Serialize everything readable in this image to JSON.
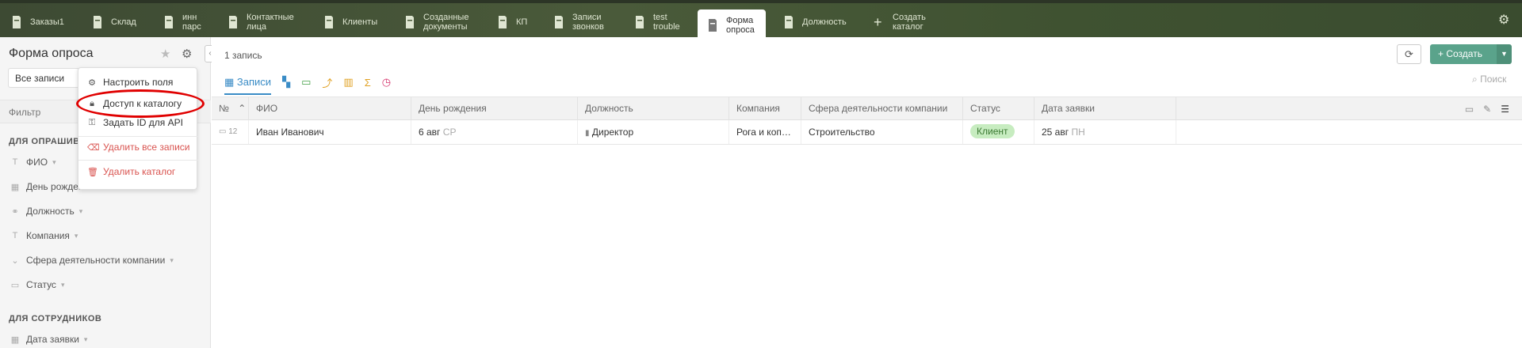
{
  "tabs": [
    {
      "label": "Заказы1"
    },
    {
      "label": "Склад"
    },
    {
      "label": "инн парс"
    },
    {
      "label": "Контактные лица"
    },
    {
      "label": "Клиенты"
    },
    {
      "label": "Созданные документы"
    },
    {
      "label": "КП"
    },
    {
      "label": "Записи звонков"
    },
    {
      "label": "test trouble"
    },
    {
      "label": "Форма опроса"
    },
    {
      "label": "Должность"
    },
    {
      "label": "Создать каталог"
    }
  ],
  "sidebar": {
    "title": "Форма опроса",
    "view_select": "Все записи",
    "filter_label": "Фильтр",
    "section_respondents": "ДЛЯ ОПРАШИВ",
    "fields": [
      "ФИО",
      "День рождения",
      "Должность",
      "Компания",
      "Сфера деятельности компании",
      "Статус"
    ],
    "section_staff": "ДЛЯ СОТРУДНИКОВ",
    "staff_fields": [
      "Дата заявки"
    ]
  },
  "menu": {
    "items": [
      "Настроить поля",
      "Доступ к каталогу",
      "Задать ID для API"
    ],
    "danger_items": [
      "Удалить все записи",
      "Удалить каталог"
    ]
  },
  "main": {
    "count": "1 запись",
    "create_label": "Создать",
    "view_records": "Записи",
    "search_label": "Поиск"
  },
  "table": {
    "columns": [
      "№",
      "ФИО",
      "День рождения",
      "Должность",
      "Компания",
      "Сфера деятельности компании",
      "Статус",
      "Дата заявки"
    ],
    "row": {
      "num": "12",
      "fio": "Иван Иванович",
      "birthday": "6 авг",
      "birthday_day": "СР",
      "position": "Директор",
      "company": "Рога и коп…",
      "sphere": "Строительство",
      "status": "Клиент",
      "date": "25 авг",
      "date_day": "ПН"
    }
  },
  "colors": {
    "accent": "#3a8cc6",
    "create": "#5aa38b",
    "status_bg": "#c7ecc0",
    "danger": "#d9534f"
  }
}
